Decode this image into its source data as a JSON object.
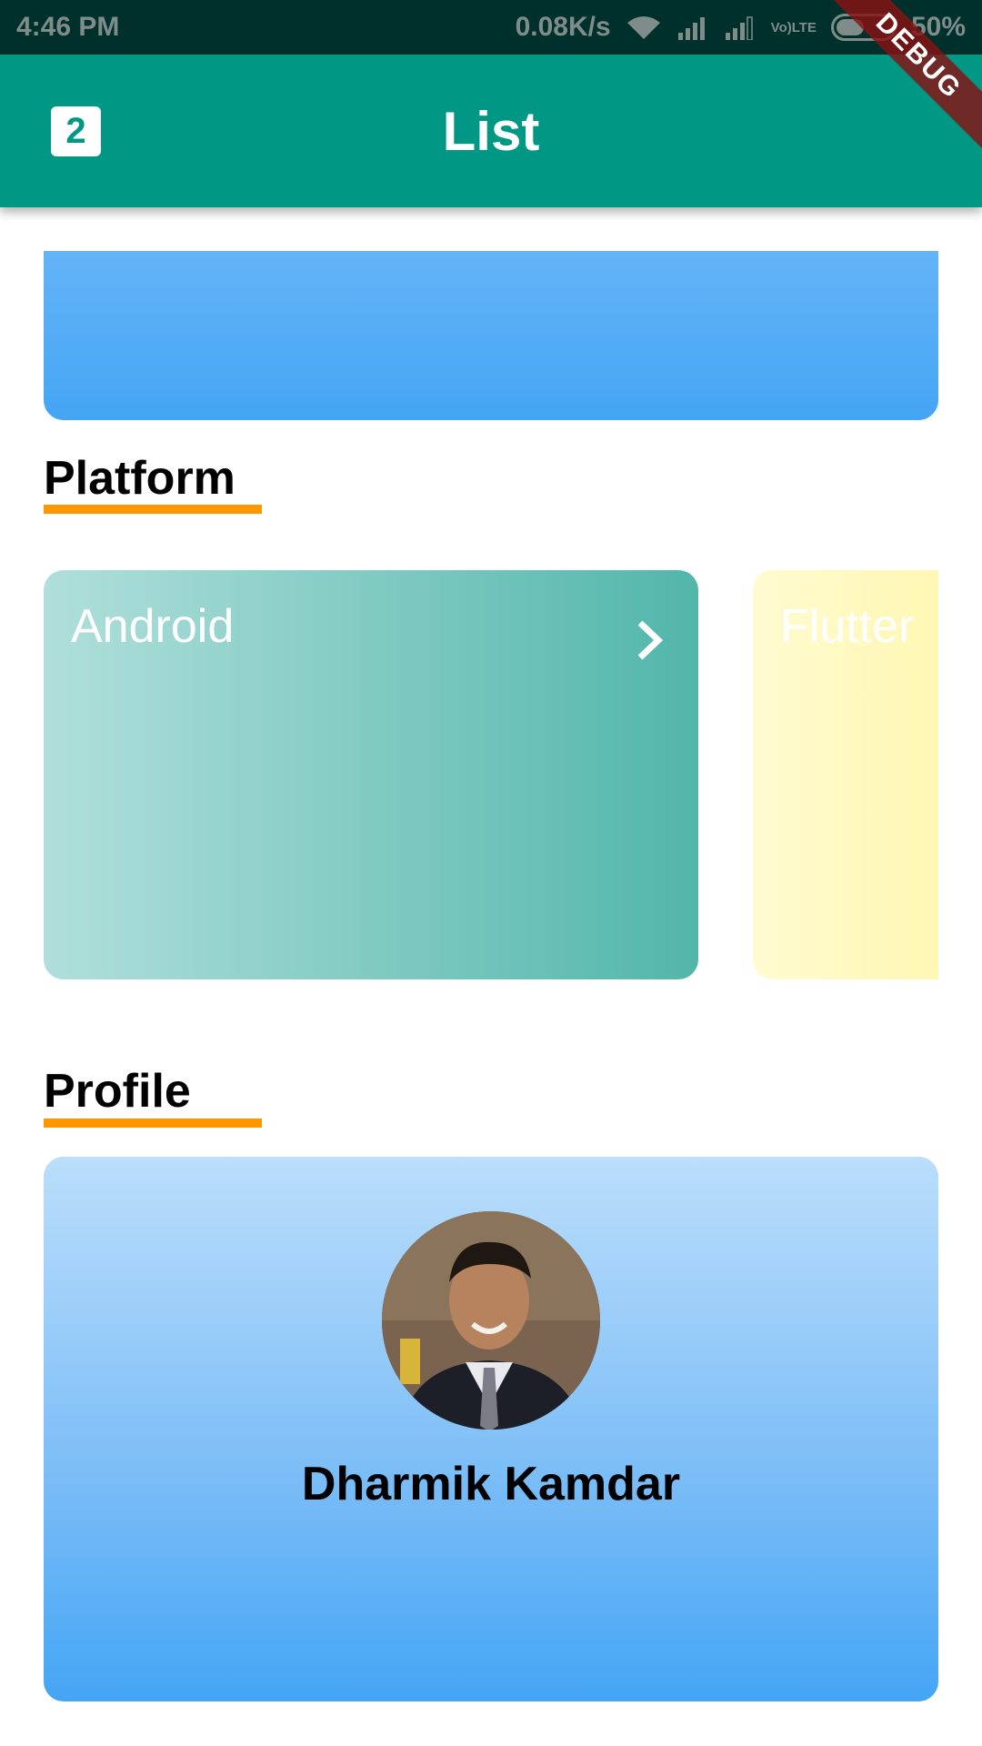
{
  "status_bar": {
    "time": "4:46 PM",
    "network_speed": "0.08K/s",
    "volte_top": "Vo)",
    "volte_bottom": "LTE",
    "battery": "50%",
    "icons": [
      "wifi-icon",
      "signal-icon",
      "signal-icon",
      "volte-icon",
      "battery-icon"
    ]
  },
  "app_bar": {
    "logo_text": "2",
    "title": "List",
    "debug_banner": "DEBUG"
  },
  "sections": {
    "platform": {
      "title": "Platform"
    },
    "profile": {
      "title": "Profile"
    }
  },
  "platform_cards": [
    {
      "label": "Android",
      "icon": "chevron-right-icon"
    },
    {
      "label": "Flutter"
    }
  ],
  "profile": {
    "name": "Dharmik Kamdar",
    "avatar": "profile-photo"
  },
  "colors": {
    "app_bar": "#009784",
    "status_bar": "#00302b",
    "accent_underline": "#ff9800",
    "blue_card": "#44a5f4",
    "android_card": "#52b6aa",
    "flutter_card": "#fff7b3"
  }
}
